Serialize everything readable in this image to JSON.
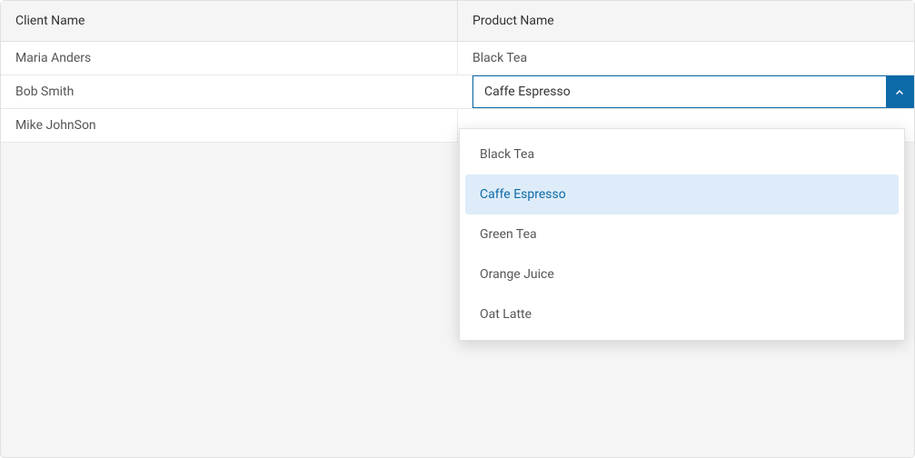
{
  "grid": {
    "columns": [
      {
        "label": "Client Name"
      },
      {
        "label": "Product Name"
      }
    ],
    "rows": [
      {
        "client": "Maria Anders",
        "product": "Black Tea"
      },
      {
        "client": "Bob Smith",
        "product": "Caffe Espresso"
      },
      {
        "client": "Mike JohnSon",
        "product": ""
      }
    ],
    "editing": {
      "rowIndex": 1,
      "value": "Caffe Espresso"
    }
  },
  "dropdown": {
    "options": [
      "Black Tea",
      "Caffe Espresso",
      "Green Tea",
      "Orange Juice",
      "Oat Latte"
    ],
    "selected": "Caffe Espresso"
  }
}
